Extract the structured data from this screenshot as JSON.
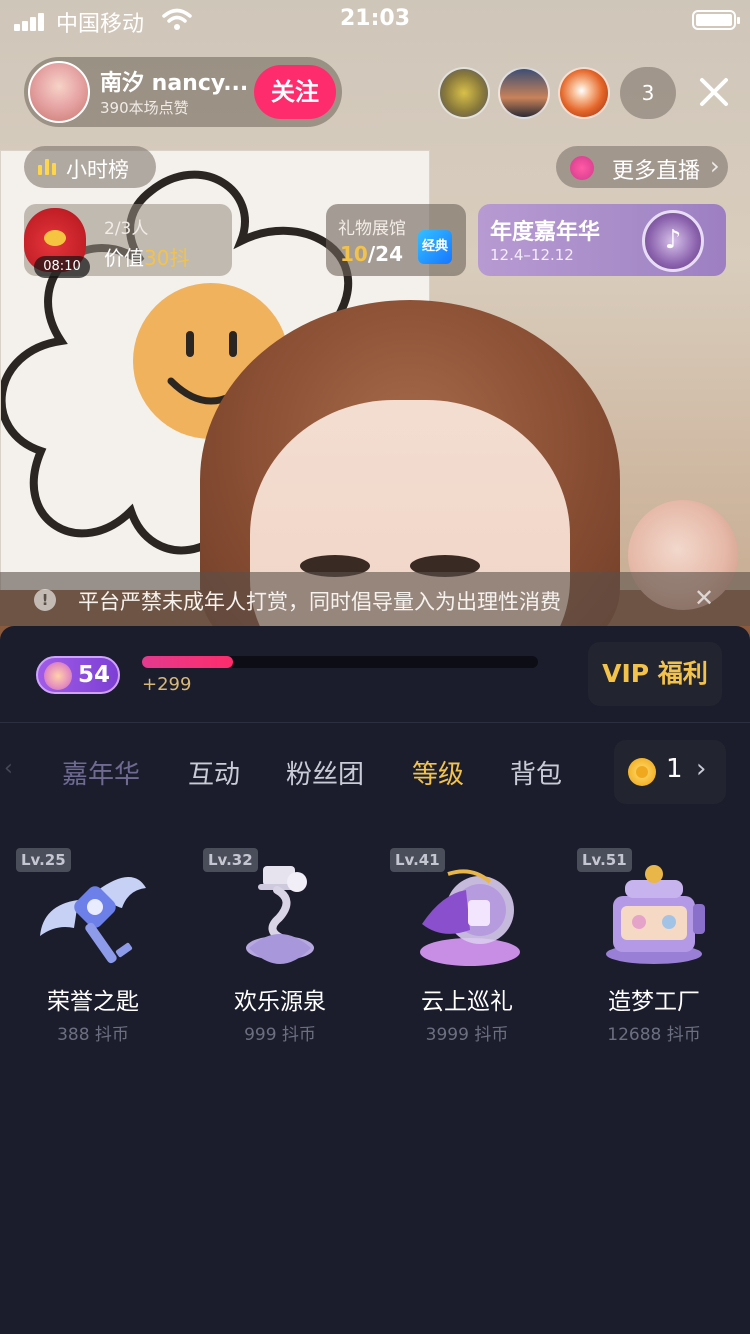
{
  "status_bar": {
    "carrier": "中国移动",
    "time": "21:03",
    "icons": [
      "signal-bars-icon",
      "wifi-icon",
      "battery-icon"
    ]
  },
  "anchor": {
    "name": "南汐 nancy...",
    "likes": "390本场点赞",
    "follow_label": "关注"
  },
  "viewers": {
    "extra_count": "3"
  },
  "hour_rank": {
    "label": "小时榜"
  },
  "more_live": {
    "label": "更多直播",
    "chevron": "›"
  },
  "red_packet": {
    "timer": "08:10",
    "people": "2/3人",
    "value_prefix": "价值",
    "value_amount": "30",
    "value_suffix": "抖"
  },
  "gift_hall": {
    "title": "礼物展馆",
    "collected": "10",
    "total": "/24",
    "badge": "经典"
  },
  "carnival": {
    "title": "年度嘉年华",
    "dates": "12.4–12.12"
  },
  "notice": {
    "icon": "!",
    "text": "平台严禁未成年人打赏，同时倡导量入为出理性消费",
    "close": "✕"
  },
  "level": {
    "number": "54",
    "progress_fraction": 0.23,
    "gain": "+299"
  },
  "vip_label": "VIP 福利",
  "tabs": [
    {
      "label": "嘉年华",
      "state": "faded"
    },
    {
      "label": "互动",
      "state": "normal"
    },
    {
      "label": "粉丝团",
      "state": "normal"
    },
    {
      "label": "等级",
      "state": "active"
    },
    {
      "label": "背包",
      "state": "normal"
    }
  ],
  "balance": {
    "amount": "1",
    "chevron": "›"
  },
  "gifts": [
    {
      "level": "Lv.25",
      "name": "荣誉之匙",
      "price": "388 抖币",
      "icon": "winged-key-icon"
    },
    {
      "level": "Lv.32",
      "name": "欢乐源泉",
      "price": "999 抖币",
      "icon": "fountain-icon"
    },
    {
      "level": "Lv.41",
      "name": "云上巡礼",
      "price": "3999 抖币",
      "icon": "cloud-ship-icon"
    },
    {
      "level": "Lv.51",
      "name": "造梦工厂",
      "price": "12688 抖币",
      "icon": "dream-factory-icon"
    }
  ],
  "colors": {
    "accent_pink": "#fe2c6c",
    "accent_gold": "#f3c24a",
    "panel_bg": "#1b1d2c"
  }
}
